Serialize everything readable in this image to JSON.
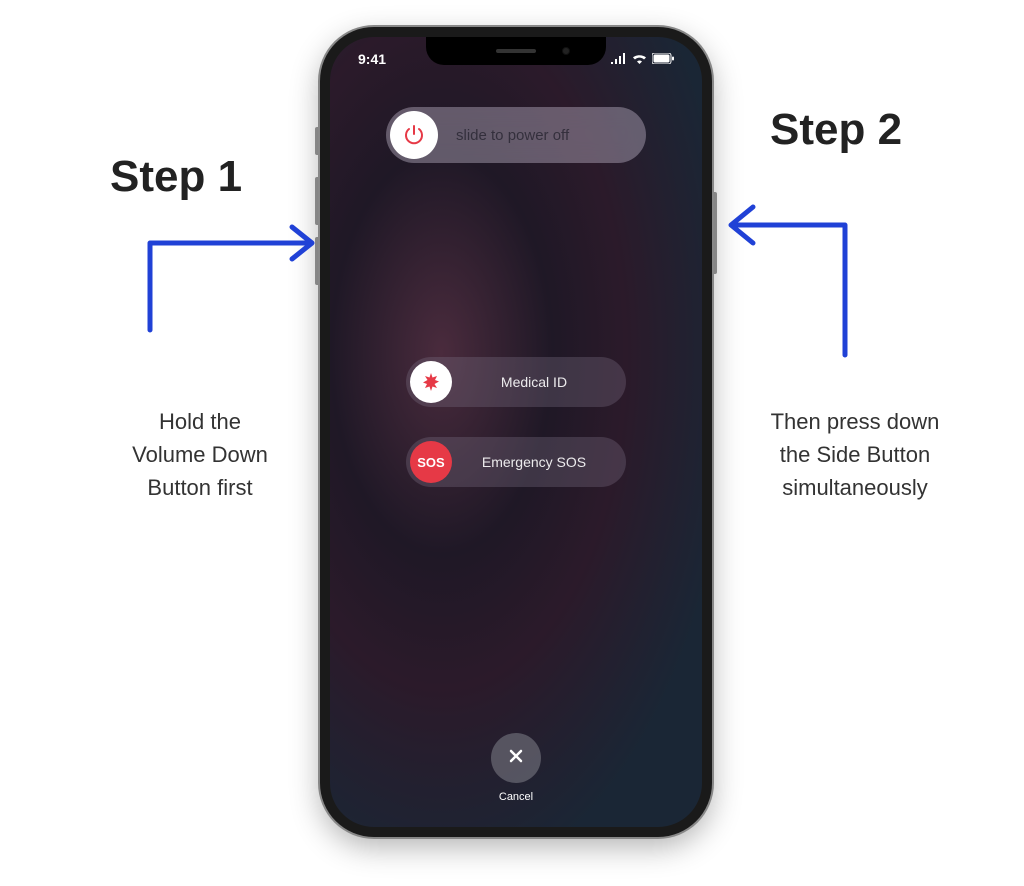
{
  "statusbar": {
    "time": "9:41"
  },
  "sliders": {
    "power_off": "slide to power off",
    "medical_id": "Medical ID",
    "emergency_sos": "Emergency SOS",
    "sos_badge": "SOS"
  },
  "cancel": {
    "label": "Cancel"
  },
  "annotations": {
    "step1_title": "Step 1",
    "step1_text": "Hold the\nVolume Down\nButton first",
    "step2_title": "Step 2",
    "step2_text": "Then press down\nthe Side Button\nsimultaneously"
  }
}
